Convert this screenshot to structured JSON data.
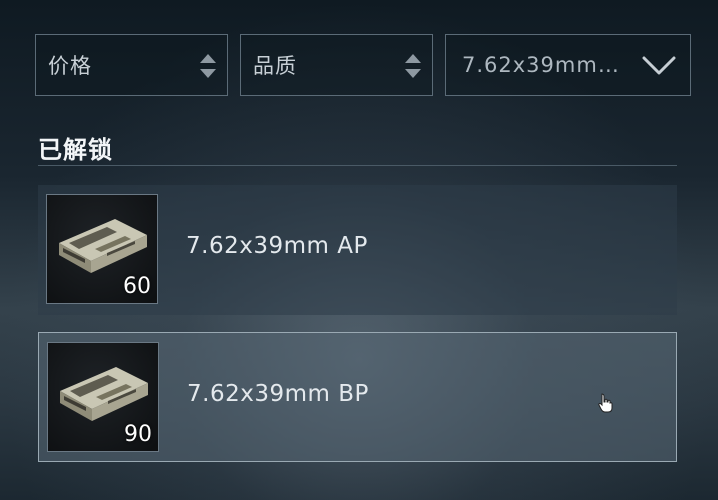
{
  "filters": {
    "price_label": "价格",
    "quality_label": "品质",
    "ammo_type_value": "7.62x39mm…"
  },
  "section": {
    "title": "已解锁"
  },
  "items": [
    {
      "name": "7.62x39mm AP",
      "count": "60"
    },
    {
      "name": "7.62x39mm BP",
      "count": "90"
    }
  ]
}
